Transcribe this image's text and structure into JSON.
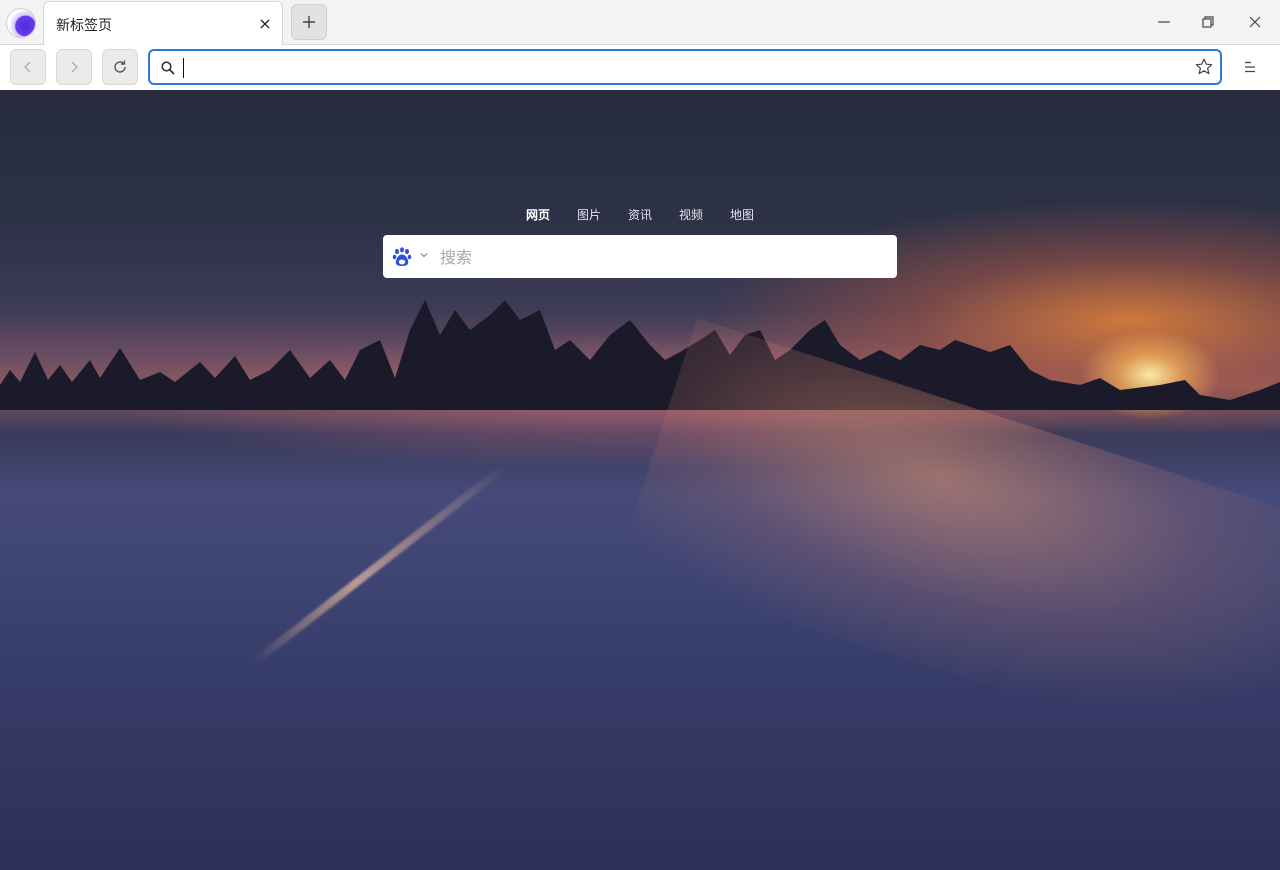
{
  "tab": {
    "title": "新标签页",
    "close_glyph": "×"
  },
  "new_tab": {
    "icon": "plus-icon"
  },
  "window_controls": [
    "minimize-icon",
    "restore-icon",
    "close-icon"
  ],
  "toolbar": {
    "back_icon": "chevron-left-icon",
    "forward_icon": "chevron-right-icon",
    "reload_icon": "reload-icon",
    "address": {
      "value": "",
      "icon": "search-icon",
      "bookmark_icon": "star-icon"
    },
    "menu_icon": "menu-icon"
  },
  "search_widget": {
    "tabs": [
      {
        "label": "网页",
        "active": true
      },
      {
        "label": "图片",
        "active": false
      },
      {
        "label": "资讯",
        "active": false
      },
      {
        "label": "视频",
        "active": false
      },
      {
        "label": "地图",
        "active": false
      }
    ],
    "engine_icon": "baidu-paw-icon",
    "placeholder": "搜索",
    "value": ""
  },
  "colors": {
    "address_focus": "#2a7bd8",
    "baidu_blue": "#3050e0"
  }
}
